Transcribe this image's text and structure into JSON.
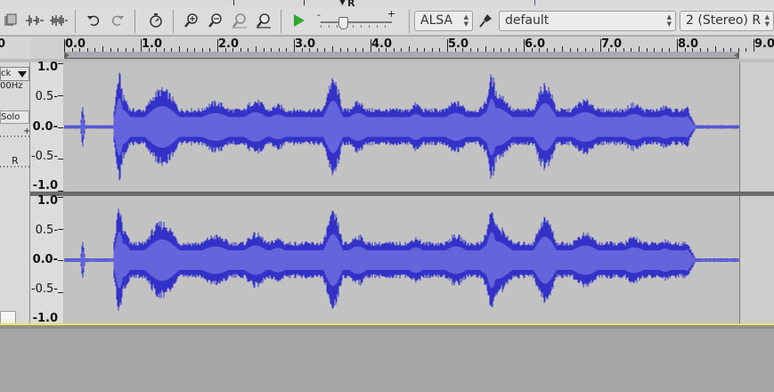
{
  "toolbar": {
    "host_label": "ALSA",
    "device_label": "default",
    "channels_label": "2 (Stereo) R",
    "slider_minus": "-",
    "slider_plus": "+",
    "meter_r": "R"
  },
  "ruler": {
    "left_label": "0",
    "labels": [
      "0.0",
      "1.0",
      "2.0",
      "3.0",
      "4.0",
      "5.0",
      "6.0",
      "7.0",
      "8.0",
      "9.0"
    ]
  },
  "track": {
    "name": "ck",
    "rate": "00Hz",
    "solo": "Solo",
    "gain_plus": "+",
    "pan_right": "R"
  },
  "scale": {
    "labels": [
      "1.0",
      "0.5-",
      "0.0-",
      "-0.5-",
      "-1.0"
    ]
  },
  "colors": {
    "waveform_peak": "#3232c8",
    "waveform_rms": "#6464dc",
    "track_bg": "#c2c2c2",
    "ruler_bg": "#d0d0d0",
    "cursor": "#e7e75d"
  },
  "icons": [
    "clip-toolbar-icon",
    "silence-audio-icon",
    "trim-audio-icon",
    "undo-icon",
    "redo-icon",
    "timer-icon",
    "zoom-in-icon",
    "zoom-out-icon",
    "fit-selection-icon",
    "fit-project-icon",
    "play-meter-icon",
    "microphone-icon"
  ]
}
